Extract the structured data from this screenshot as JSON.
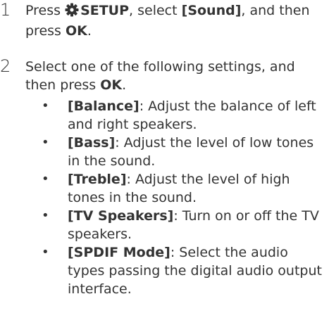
{
  "steps": [
    {
      "number": "1",
      "parts": {
        "press": "Press",
        "setup": "SETUP",
        "mid": ", select",
        "sound": "[Sound]",
        "then": ", and then press",
        "ok": "OK",
        "end": "."
      }
    },
    {
      "number": "2",
      "parts": {
        "text": "Select one of the following settings, and then press",
        "ok": "OK",
        "end": "."
      }
    }
  ],
  "settings": [
    {
      "name": "[Balance]",
      "desc": ": Adjust the balance of left and right speakers."
    },
    {
      "name": "[Bass]",
      "desc": ": Adjust the level of low tones in the sound."
    },
    {
      "name": "[Treble]",
      "desc": ": Adjust the level of high tones in the sound."
    },
    {
      "name": "[TV Speakers]",
      "desc": ": Turn on or off the TV speakers."
    },
    {
      "name": "[SPDIF Mode]",
      "desc": ": Select the audio types passing the digital audio output interface."
    }
  ],
  "icons": {
    "setup": "gear-icon"
  },
  "bullet": "•"
}
